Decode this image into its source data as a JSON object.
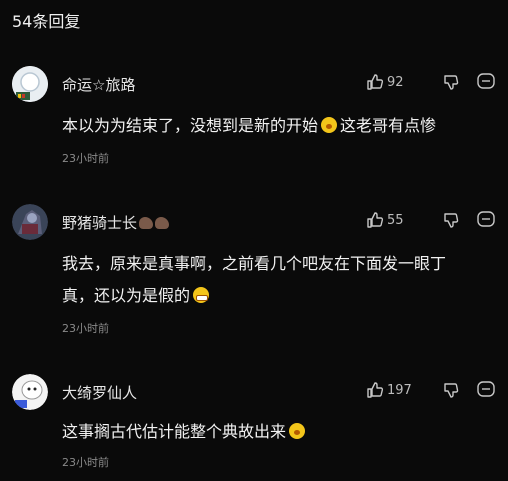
{
  "header": {
    "title": "54条回复"
  },
  "comments": [
    {
      "username": "命运☆旅路",
      "text_before": "本以为为结束了，没想到是新的开始",
      "text_after": "这老哥有点惨",
      "time": "23小时前",
      "likes": "92",
      "avatar_icon": "robot-avatar"
    },
    {
      "username": "野猪骑士长",
      "text_before": "我去，原来是真事啊，之前看几个吧友在下面发一眼丁真，还以为是假的",
      "text_after": "",
      "time": "23小时前",
      "likes": "55",
      "avatar_icon": "knight-avatar"
    },
    {
      "username": "大绮罗仙人",
      "text_before": "这事搁古代估计能整个典故出来",
      "text_after": "",
      "time": "23小时前",
      "likes": "197",
      "avatar_icon": "cartoon-avatar"
    }
  ]
}
